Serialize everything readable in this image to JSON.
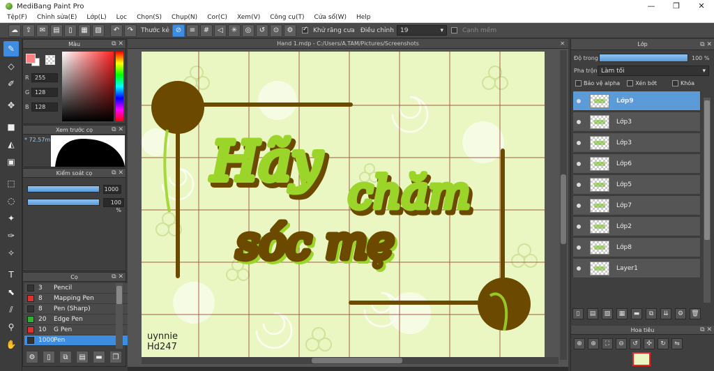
{
  "window": {
    "title": "MediBang Paint Pro",
    "min": "—",
    "max": "❐",
    "close": "✕"
  },
  "menu": [
    "Tệp(F)",
    "Chỉnh sửa(E)",
    "Lớp(L)",
    "Lọc",
    "Chọn(S)",
    "Chụp(N)",
    "Cor(C)",
    "Xem(V)",
    "Công cụ(T)",
    "Cửa sổ(W)",
    "Help"
  ],
  "toolbar": {
    "ruler_label": "Thước kẻ",
    "antialias_label": "Khử răng cưa",
    "adjust_label": "Điều chỉnh",
    "adjust_value": "19",
    "softedge_label": "Cạnh mềm"
  },
  "color_panel": {
    "title": "Màu",
    "r_label": "R",
    "g_label": "G",
    "b_label": "B",
    "r": "255",
    "g": "128",
    "b": "128",
    "fg_color": "#ff8080"
  },
  "preview_panel": {
    "title": "Xem trước cọ",
    "size_text": "* 72.57mm"
  },
  "brush_control": {
    "title": "Kiểm soát cọ",
    "size_value": "1000",
    "opacity_value": "100 %",
    "opacity_pct": 100
  },
  "brush_panel": {
    "title": "Cọ",
    "items": [
      {
        "size": "3",
        "name": "Pencil",
        "color": "#333333"
      },
      {
        "size": "8",
        "name": "Mapping Pen",
        "color": "#e03030"
      },
      {
        "size": "8",
        "name": "Pen (Sharp)",
        "color": "#333333"
      },
      {
        "size": "20",
        "name": "Edge Pen",
        "color": "#30b030"
      },
      {
        "size": "10",
        "name": "G Pen",
        "color": "#e03030"
      },
      {
        "size": "1000",
        "name": "Pen",
        "color": "#333333"
      }
    ]
  },
  "document": {
    "tab_title": "Hand 1.mdp - C:/Users/A.TAM/Pictures/Screenshots",
    "close": "✕",
    "signature_line1": "uynnie",
    "signature_line2": "Hd247"
  },
  "layer_panel": {
    "title": "Lớp",
    "opacity_label": "Độ trong",
    "opacity_value": "100 %",
    "opacity_pct": 100,
    "blend_label": "Pha trộn",
    "blend_value": "Làm tối",
    "protect_alpha": "Bảo vệ alpha",
    "clipping": "Xén bớt",
    "lock": "Khóa",
    "layers": [
      "Lớp9",
      "Lớp3",
      "Lớp3",
      "Lớp6",
      "Lớp5",
      "Lớp7",
      "Lớp2",
      "Lớp8",
      "Layer1"
    ]
  },
  "navigator": {
    "title": "Hoa tiêu"
  },
  "colors": {
    "accent": "#3d8ee0",
    "canvas_bg": "#eaf7c2",
    "lime": "#9bd52a",
    "brown": "#6b4a00"
  }
}
